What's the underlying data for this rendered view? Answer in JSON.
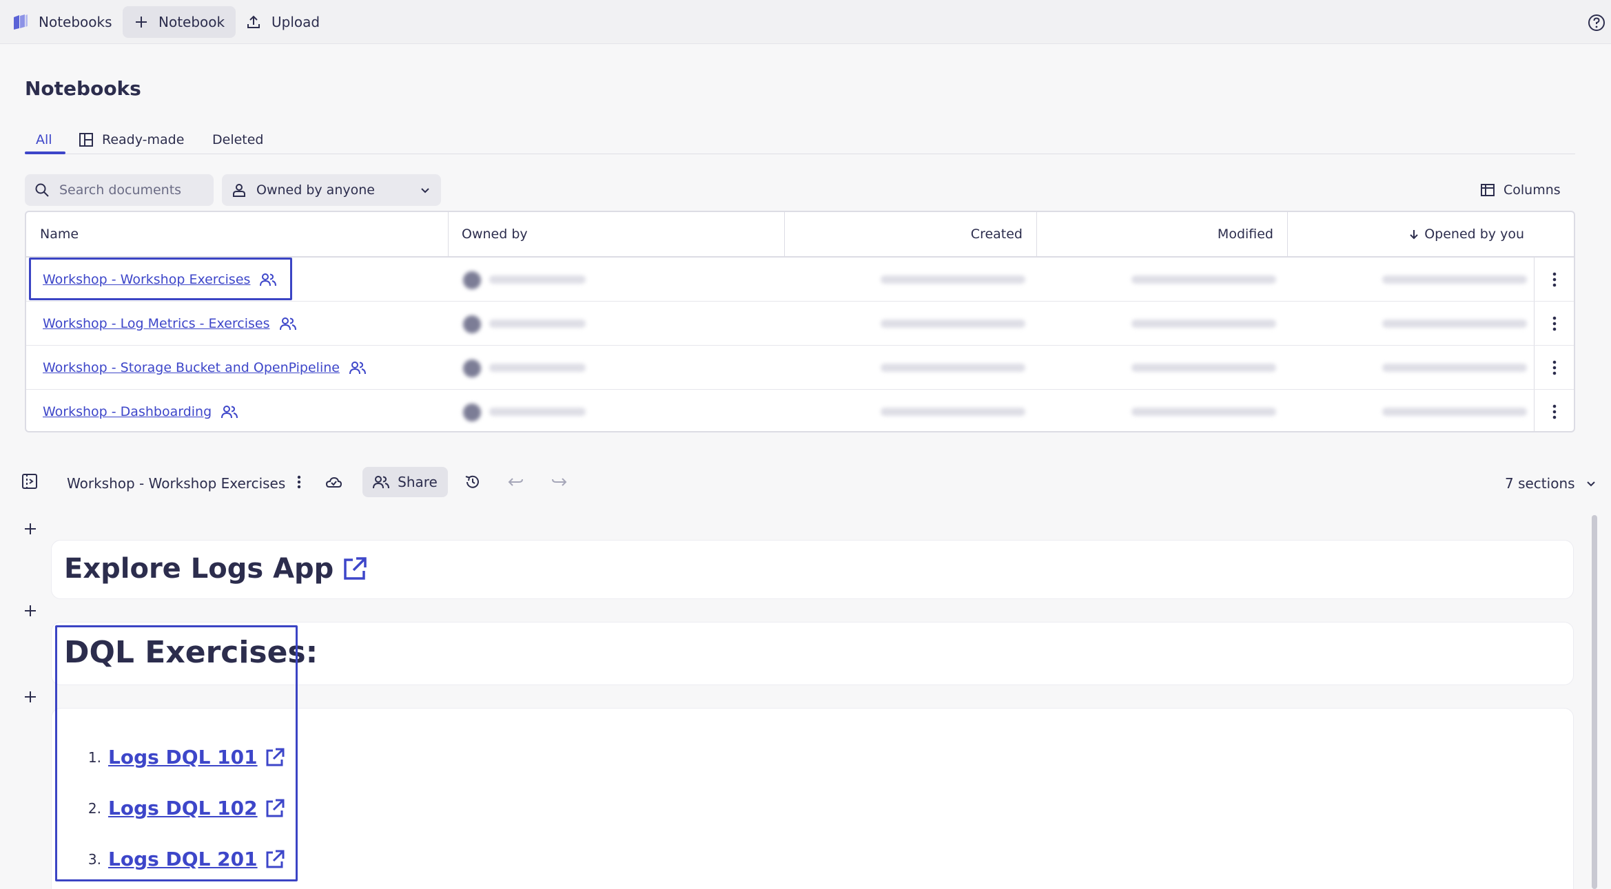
{
  "topbar": {
    "notebooks_label": "Notebooks",
    "new_notebook_label": "Notebook",
    "upload_label": "Upload"
  },
  "page": {
    "title": "Notebooks",
    "tabs": [
      {
        "label": "All",
        "active": true
      },
      {
        "label": "Ready-made",
        "active": false
      },
      {
        "label": "Deleted",
        "active": false
      }
    ]
  },
  "filters": {
    "search_placeholder": "Search documents",
    "owner_filter": "Owned by anyone",
    "columns_label": "Columns"
  },
  "table": {
    "headers": {
      "name": "Name",
      "owned_by": "Owned by",
      "created": "Created",
      "modified": "Modified",
      "opened_by_you": "Opened by you"
    },
    "rows": [
      {
        "name": "Workshop - Workshop Exercises",
        "shared": true
      },
      {
        "name": "Workshop - Log Metrics - Exercises",
        "shared": true
      },
      {
        "name": "Workshop - Storage Bucket and OpenPipeline",
        "shared": true
      },
      {
        "name": "Workshop - Dashboarding",
        "shared": true
      }
    ]
  },
  "editor": {
    "notebook_title": "Workshop - Workshop Exercises",
    "share_label": "Share",
    "sections_label": "7 sections",
    "section1_heading": "Explore Logs App",
    "section2_heading": "DQL Exercises:",
    "list": [
      {
        "num": "1.",
        "label": "Logs DQL 101"
      },
      {
        "num": "2.",
        "label": "Logs DQL 102"
      },
      {
        "num": "3.",
        "label": "Logs DQL 201"
      }
    ]
  },
  "colors": {
    "accent": "#3d46c9",
    "text": "#2c2d4d",
    "highlight_box": "#3b44c4"
  }
}
